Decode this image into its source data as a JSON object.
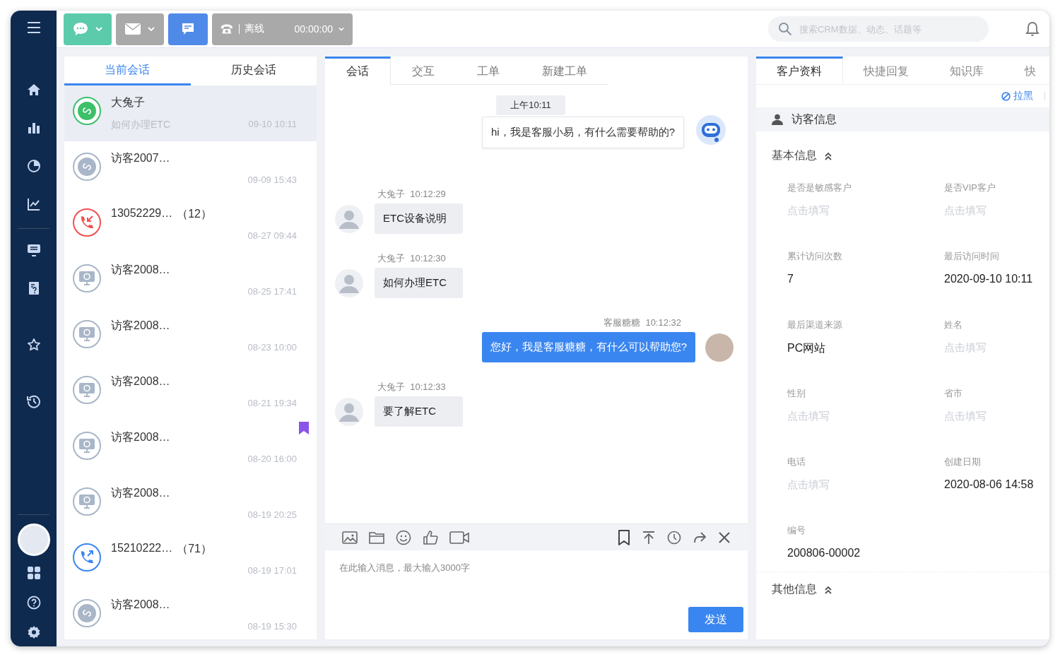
{
  "toolbar": {
    "phone_status": "离线",
    "timer": "00:00:00",
    "search": {
      "placeholder": "搜索CRM数据、动态、话题等"
    }
  },
  "conversation_tabs": [
    {
      "label": "当前会话",
      "selected": true
    },
    {
      "label": "历史会话",
      "selected": false
    }
  ],
  "conversations": [
    {
      "kind": "mini",
      "name": "大兔子",
      "preview": "如何办理ETC",
      "time": "09-10 10:11",
      "selected": true,
      "bookmarked": false
    },
    {
      "kind": "mini",
      "name": "访客2007…",
      "time": "09-09 15:43",
      "selected": false,
      "bookmarked": false
    },
    {
      "kind": "call_in",
      "name": "13052229…",
      "count": "（12）",
      "time": "08-27 09:44",
      "selected": false,
      "bookmarked": false
    },
    {
      "kind": "web",
      "name": "访客2008…",
      "time": "08-25 17:41",
      "selected": false,
      "bookmarked": false
    },
    {
      "kind": "web",
      "name": "访客2008…",
      "time": "08-23 10:00",
      "selected": false,
      "bookmarked": false
    },
    {
      "kind": "web",
      "name": "访客2008…",
      "time": "08-21 19:34",
      "selected": false,
      "bookmarked": false
    },
    {
      "kind": "web",
      "name": "访客2008…",
      "time": "08-20 16:00",
      "selected": false,
      "bookmarked": true
    },
    {
      "kind": "web",
      "name": "访客2008…",
      "time": "08-19 20:25",
      "selected": false,
      "bookmarked": false
    },
    {
      "kind": "call_out",
      "name": "15210222…",
      "count": "（71）",
      "time": "08-19 17:01",
      "selected": false,
      "bookmarked": false
    },
    {
      "kind": "mini",
      "name": "访客2008…",
      "time": "08-19 15:30",
      "selected": false,
      "bookmarked": false
    }
  ],
  "chat_tabs": [
    {
      "label": "会话",
      "selected": true
    },
    {
      "label": "交互",
      "selected": false
    },
    {
      "label": "工单",
      "selected": false
    },
    {
      "label": "新建工单",
      "selected": false
    }
  ],
  "messages": [
    {
      "kind": "time",
      "text": "上午10:11"
    },
    {
      "kind": "bot",
      "text": "hi，我是客服小易，有什么需要帮助的?"
    },
    {
      "kind": "customer",
      "sender": "大兔子",
      "time": "10:12:29",
      "text": "ETC设备说明"
    },
    {
      "kind": "customer",
      "sender": "大兔子",
      "time": "10:12:30",
      "text": "如何办理ETC"
    },
    {
      "kind": "agent",
      "sender": "客服糖糖",
      "time": "10:12:32",
      "text": "您好，我是客服糖糖，有什么可以帮助您?"
    },
    {
      "kind": "customer",
      "sender": "大兔子",
      "time": "10:12:33",
      "text": "要了解ETC"
    }
  ],
  "composer": {
    "placeholder": "在此输入消息，最大输入3000字",
    "send": "发送"
  },
  "profile_tabs": [
    {
      "label": "客户资料",
      "selected": true
    },
    {
      "label": "快捷回复",
      "selected": false
    },
    {
      "label": "知识库",
      "selected": false
    },
    {
      "label": "快",
      "selected": false
    }
  ],
  "blacklist": "拉黑",
  "visitor_header": "访客信息",
  "sections": [
    {
      "title": "基本信息",
      "expanded": true,
      "fields": [
        {
          "label": "是否是敏感客户",
          "placeholder": "点击填写"
        },
        {
          "label": "是否VIP客户",
          "placeholder": "点击填写"
        },
        {
          "label": "累计访问次数",
          "value": "7"
        },
        {
          "label": "最后访问时间",
          "value": "2020-09-10 10:11"
        },
        {
          "label": "最后渠道来源",
          "value": "PC网站"
        },
        {
          "label": "姓名",
          "placeholder": "点击填写"
        },
        {
          "label": "性别",
          "placeholder": "点击填写"
        },
        {
          "label": "省市",
          "placeholder": "点击填写"
        },
        {
          "label": "电话",
          "placeholder": "点击填写"
        },
        {
          "label": "创建日期",
          "value": "2020-08-06 14:58"
        },
        {
          "label": "编号",
          "value": "200806-00002"
        }
      ]
    },
    {
      "title": "其他信息",
      "expanded": true
    }
  ]
}
